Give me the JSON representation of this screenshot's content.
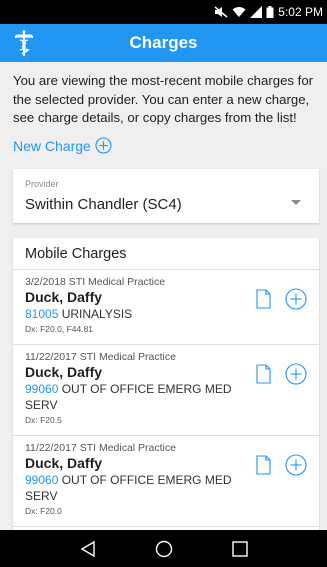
{
  "status_bar": {
    "time": "5:02 PM"
  },
  "app_bar": {
    "title": "Charges",
    "logo_icon": "caduceus-icon"
  },
  "intro": {
    "text": "You are viewing the most-recent mobile charges for the selected provider. You can enter a new charge, see charge details, or copy charges from the list!"
  },
  "new_charge": {
    "label": "New Charge"
  },
  "provider": {
    "label": "Provider",
    "value": "Swithin Chandler (SC4)"
  },
  "mobile_charges": {
    "title": "Mobile Charges",
    "items": [
      {
        "meta": "3/2/2018 STI Medical Practice",
        "patient": "Duck, Daffy",
        "code": "81005",
        "description": "URINALYSIS",
        "dx": "Dx: F20.0, F44.81"
      },
      {
        "meta": "11/22/2017 STI Medical Practice",
        "patient": "Duck, Daffy",
        "code": "99060",
        "description": "OUT OF OFFICE EMERG MED SERV",
        "dx": "Dx: F20.5"
      },
      {
        "meta": "11/22/2017 STI Medical Practice",
        "patient": "Duck, Daffy",
        "code": "99060",
        "description": "OUT OF OFFICE EMERG MED SERV",
        "dx": "Dx: F20.0"
      }
    ]
  },
  "colors": {
    "primary": "#2196f3",
    "status_bar": "#000000",
    "background": "#efefef"
  }
}
